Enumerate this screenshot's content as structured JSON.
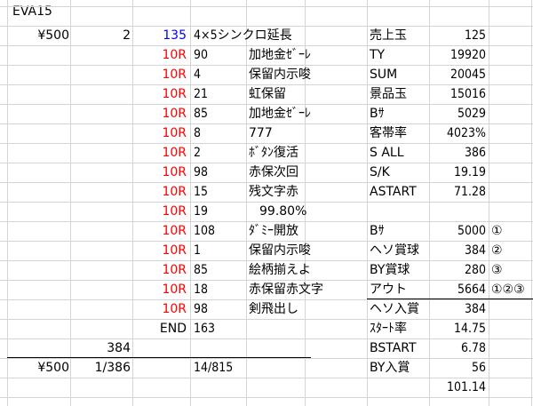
{
  "sheet": {
    "title": "EVA15",
    "rows": [
      {
        "a": "¥500",
        "b": "2",
        "c": "135",
        "d": "4×5シンクロ延長",
        "e": "",
        "f": "売上玉",
        "g": "125",
        "h": ""
      },
      {
        "a": "",
        "b": "",
        "c": "10R",
        "d": "90",
        "e": "加地金ｾﾞｰﾚ",
        "f": "TY",
        "g": "19920",
        "h": ""
      },
      {
        "a": "",
        "b": "",
        "c": "10R",
        "d": "4",
        "e": "保留内示唆",
        "f": "SUM",
        "g": "20045",
        "h": ""
      },
      {
        "a": "",
        "b": "",
        "c": "10R",
        "d": "21",
        "e": "虹保留",
        "f": "景品玉",
        "g": "15016",
        "h": ""
      },
      {
        "a": "",
        "b": "",
        "c": "10R",
        "d": "85",
        "e": "加地金ｾﾞｰﾚ",
        "f": "Bｻ",
        "g": "5029",
        "h": ""
      },
      {
        "a": "",
        "b": "",
        "c": "10R",
        "d": "8",
        "e": "777",
        "f": "客帯率",
        "g": "4023%",
        "h": ""
      },
      {
        "a": "",
        "b": "",
        "c": "10R",
        "d": "2",
        "e": "ﾎﾞﾀﾝ復活",
        "f": "S ALL",
        "g": "386",
        "h": ""
      },
      {
        "a": "",
        "b": "",
        "c": "10R",
        "d": "98",
        "e": "赤保次回",
        "f": "S/K",
        "g": "19.19",
        "h": ""
      },
      {
        "a": "",
        "b": "",
        "c": "10R",
        "d": "15",
        "e": "残文字赤",
        "f": "ASTART",
        "g": "71.28",
        "h": ""
      },
      {
        "a": "",
        "b": "",
        "c": "10R",
        "d": "19",
        "e": "99.80%",
        "f": "",
        "g": "",
        "h": ""
      },
      {
        "a": "",
        "b": "",
        "c": "10R",
        "d": "108",
        "e": "ﾀﾞﾐｰ開放",
        "f": "Bｻ",
        "g": "5000",
        "h": "①"
      },
      {
        "a": "",
        "b": "",
        "c": "10R",
        "d": "1",
        "e": "保留内示唆",
        "f": "ヘソ賞球",
        "g": "384",
        "h": "②"
      },
      {
        "a": "",
        "b": "",
        "c": "10R",
        "d": "85",
        "e": "絵柄揃えよ",
        "f": "BY賞球",
        "g": "280",
        "h": "③"
      },
      {
        "a": "",
        "b": "",
        "c": "10R",
        "d": "18",
        "e": "赤保留赤文字",
        "f": "アウト",
        "g": "5664",
        "h": "①②③"
      },
      {
        "a": "",
        "b": "",
        "c": "10R",
        "d": "98",
        "e": "剣飛出し",
        "f": "ヘソ入賞",
        "g": "384",
        "h": ""
      },
      {
        "a": "",
        "b": "",
        "c": "END",
        "d": "163",
        "e": "",
        "f": "ｽﾀｰﾄ率",
        "g": "14.75",
        "h": ""
      },
      {
        "a": "",
        "b": "384",
        "c": "",
        "d": "",
        "e": "",
        "f": "BSTART",
        "g": "6.78",
        "h": ""
      },
      {
        "a": "¥500",
        "b": "1/386",
        "c": "",
        "d": "14/815",
        "e": "",
        "f": "BY入賞",
        "g": "56",
        "h": ""
      },
      {
        "a": "",
        "b": "",
        "c": "",
        "d": "",
        "e": "",
        "f": "",
        "g": "101.14",
        "h": ""
      }
    ]
  },
  "colors": {
    "round_label": "#ff0000",
    "spin_count": "#0000ff",
    "gridline": "#d4d4d4"
  }
}
